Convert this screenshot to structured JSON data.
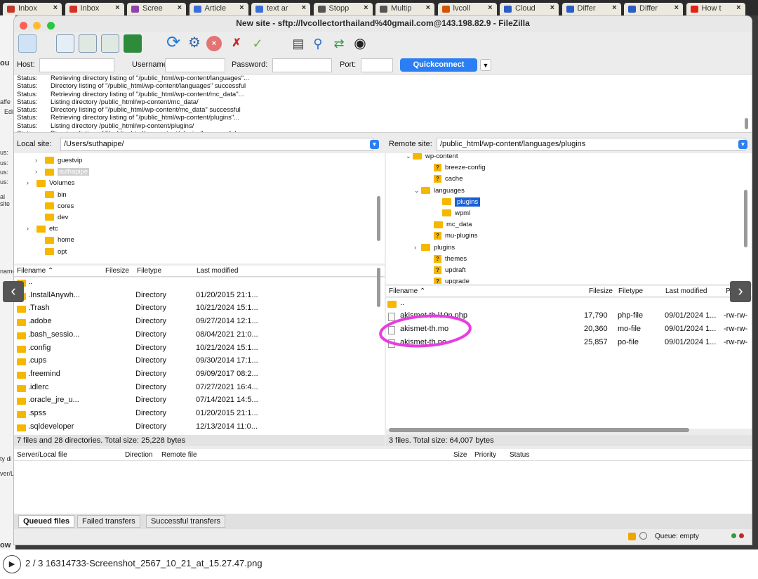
{
  "browser_tabs": [
    {
      "label": "Inbox",
      "color": "#c0392b"
    },
    {
      "label": "Inbox",
      "color": "#d93025"
    },
    {
      "label": "Scree",
      "color": "#8e44ad"
    },
    {
      "label": "Article",
      "color": "#3b6fd8"
    },
    {
      "label": "text ar",
      "color": "#3b6fd8"
    },
    {
      "label": "Stopp",
      "color": "#555555"
    },
    {
      "label": "Multip",
      "color": "#555555"
    },
    {
      "label": "lvcoll",
      "color": "#d35400"
    },
    {
      "label": "Cloud",
      "color": "#2c5cc5"
    },
    {
      "label": "Differ",
      "color": "#2c5cc5"
    },
    {
      "label": "Differ",
      "color": "#2c5cc5"
    },
    {
      "label": "How t",
      "color": "#e62117"
    }
  ],
  "window": {
    "title": "New site - sftp://lvcollectorthailand%40gmail.com@143.198.82.9 - FileZilla"
  },
  "quickconnect": {
    "host_label": "Host:",
    "username_label": "Username:",
    "password_label": "Password:",
    "port_label": "Port:",
    "button_label": "Quickconnect"
  },
  "message_log": [
    {
      "key": "Status:",
      "text": "Retrieving directory listing of \"/public_html/wp-content/languages\"..."
    },
    {
      "key": "Status:",
      "text": "Directory listing of \"/public_html/wp-content/languages\" successful"
    },
    {
      "key": "Status:",
      "text": "Retrieving directory listing of \"/public_html/wp-content/mc_data\"..."
    },
    {
      "key": "Status:",
      "text": "Listing directory /public_html/wp-content/mc_data/"
    },
    {
      "key": "Status:",
      "text": "Directory listing of \"/public_html/wp-content/mc_data\" successful"
    },
    {
      "key": "Status:",
      "text": "Retrieving directory listing of \"/public_html/wp-content/plugins\"..."
    },
    {
      "key": "Status:",
      "text": "Listing directory /public_html/wp-content/plugins/"
    },
    {
      "key": "Status:",
      "text": "Directory listing of \"/public_html/wp-content/plugins\" successful"
    }
  ],
  "local": {
    "site_label": "Local site:",
    "site_path": "/Users/suthapipe/",
    "tree": [
      {
        "label": "guestvip",
        "chev": ">"
      },
      {
        "label": "suthapipe",
        "chev": ">"
      },
      {
        "label": "Volumes",
        "chev": ">"
      },
      {
        "label": "bin",
        "chev": ""
      },
      {
        "label": "cores",
        "chev": ""
      },
      {
        "label": "dev",
        "chev": ""
      },
      {
        "label": "etc",
        "chev": ">"
      },
      {
        "label": "home",
        "chev": ""
      },
      {
        "label": "opt",
        "chev": ""
      }
    ],
    "columns": {
      "filename": "Filename",
      "filesize": "Filesize",
      "filetype": "Filetype",
      "modified": "Last modified"
    },
    "files": [
      {
        "name": "..",
        "type": "",
        "modified": ""
      },
      {
        "name": ".InstallAnywh...",
        "type": "Directory",
        "modified": "01/20/2015 21:1..."
      },
      {
        "name": ".Trash",
        "type": "Directory",
        "modified": "10/21/2024 15:1..."
      },
      {
        "name": ".adobe",
        "type": "Directory",
        "modified": "09/27/2014 12:1..."
      },
      {
        "name": ".bash_sessio...",
        "type": "Directory",
        "modified": "08/04/2021 21:0..."
      },
      {
        "name": ".config",
        "type": "Directory",
        "modified": "10/21/2024 15:1..."
      },
      {
        "name": ".cups",
        "type": "Directory",
        "modified": "09/30/2014 17:1..."
      },
      {
        "name": ".freemind",
        "type": "Directory",
        "modified": "09/09/2017 08:2..."
      },
      {
        "name": ".idlerc",
        "type": "Directory",
        "modified": "07/27/2021 16:4..."
      },
      {
        "name": ".oracle_jre_u...",
        "type": "Directory",
        "modified": "07/14/2021 14:5..."
      },
      {
        "name": ".spss",
        "type": "Directory",
        "modified": "01/20/2015 21:1..."
      },
      {
        "name": ".sqldeveloper",
        "type": "Directory",
        "modified": "12/13/2014 11:0..."
      }
    ],
    "status": "7 files and 28 directories. Total size: 25,228 bytes"
  },
  "remote": {
    "site_label": "Remote site:",
    "site_path": "/public_html/wp-content/languages/plugins",
    "tree": [
      {
        "label": "wp-content",
        "chev": "v",
        "q": false
      },
      {
        "label": "breeze-config",
        "chev": "",
        "q": true
      },
      {
        "label": "cache",
        "chev": "",
        "q": true
      },
      {
        "label": "languages",
        "chev": "v",
        "q": false
      },
      {
        "label": "plugins",
        "chev": "",
        "q": false
      },
      {
        "label": "wpml",
        "chev": "",
        "q": false
      },
      {
        "label": "mc_data",
        "chev": "",
        "q": false
      },
      {
        "label": "mu-plugins",
        "chev": "",
        "q": true
      },
      {
        "label": "plugins",
        "chev": ">",
        "q": false
      },
      {
        "label": "themes",
        "chev": "",
        "q": true
      },
      {
        "label": "updraft",
        "chev": "",
        "q": true
      },
      {
        "label": "upgrade",
        "chev": "",
        "q": true
      }
    ],
    "columns": {
      "filename": "Filename",
      "filesize": "Filesize",
      "filetype": "Filetype",
      "modified": "Last modified",
      "perms": "Perms"
    },
    "files": [
      {
        "name": "..",
        "size": "",
        "type": "",
        "modified": "",
        "perms": ""
      },
      {
        "name": "akismet-th.l10n.php",
        "size": "17,790",
        "type": "php-file",
        "modified": "09/01/2024 1...",
        "perms": "-rw-rw-"
      },
      {
        "name": "akismet-th.mo",
        "size": "20,360",
        "type": "mo-file",
        "modified": "09/01/2024 1...",
        "perms": "-rw-rw-"
      },
      {
        "name": "akismet-th.po",
        "size": "25,857",
        "type": "po-file",
        "modified": "09/01/2024 1...",
        "perms": "-rw-rw-"
      }
    ],
    "status": "3 files. Total size: 64,007 bytes"
  },
  "queue": {
    "columns": {
      "server": "Server/Local file",
      "direction": "Direction",
      "remote": "Remote file",
      "size": "Size",
      "priority": "Priority",
      "status": "Status"
    },
    "tabs": [
      "Queued files",
      "Failed transfers",
      "Successful transfers"
    ],
    "status": "Queue: empty"
  },
  "caption": {
    "text": "2 / 3 16314733-Screenshot_2567_10_21_at_15.27.47.png"
  },
  "annotation_color": "#e83de0"
}
